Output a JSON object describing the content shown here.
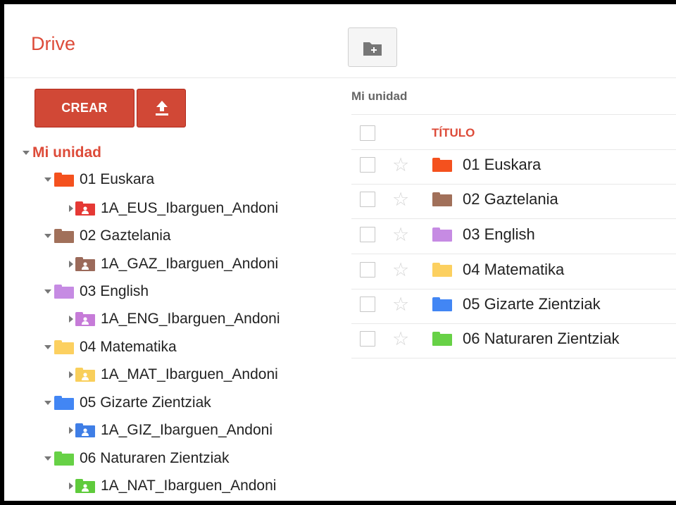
{
  "header": {
    "brand": "Drive",
    "new_folder_icon": "new-folder-icon"
  },
  "sidebar": {
    "create_label": "CREAR",
    "upload_icon": "upload-icon",
    "root_label": "Mi unidad",
    "folders": [
      {
        "label": "01 Euskara",
        "color": "#f4511e",
        "child": {
          "label": "1A_EUS_Ibarguen_Andoni",
          "color": "#e53935"
        }
      },
      {
        "label": "02 Gaztelania",
        "color": "#a1705a",
        "child": {
          "label": "1A_GAZ_Ibarguen_Andoni",
          "color": "#9b6a5a"
        }
      },
      {
        "label": "03 English",
        "color": "#c68be3",
        "child": {
          "label": "1A_ENG_Ibarguen_Andoni",
          "color": "#c67bd8"
        }
      },
      {
        "label": "04 Matematika",
        "color": "#fcd060",
        "child": {
          "label": "1A_MAT_Ibarguen_Andoni",
          "color": "#f9cf5b"
        }
      },
      {
        "label": "05 Gizarte Zientziak",
        "color": "#4286f4",
        "child": {
          "label": "1A_GIZ_Ibarguen_Andoni",
          "color": "#3f7ee6"
        }
      },
      {
        "label": "06 Naturaren Zientziak",
        "color": "#67d146",
        "child": {
          "label": "1A_NAT_Ibarguen_Andoni",
          "color": "#5fcb3c"
        }
      }
    ]
  },
  "main": {
    "breadcrumb": "Mi unidad",
    "column_title": "TÍTULO",
    "rows": [
      {
        "label": "01 Euskara",
        "color": "#f4511e"
      },
      {
        "label": "02 Gaztelania",
        "color": "#a1705a"
      },
      {
        "label": "03 English",
        "color": "#c68be3"
      },
      {
        "label": "04 Matematika",
        "color": "#fcd060"
      },
      {
        "label": "05 Gizarte Zientziak",
        "color": "#4286f4"
      },
      {
        "label": "06 Naturaren Zientziak",
        "color": "#67d146"
      }
    ]
  }
}
